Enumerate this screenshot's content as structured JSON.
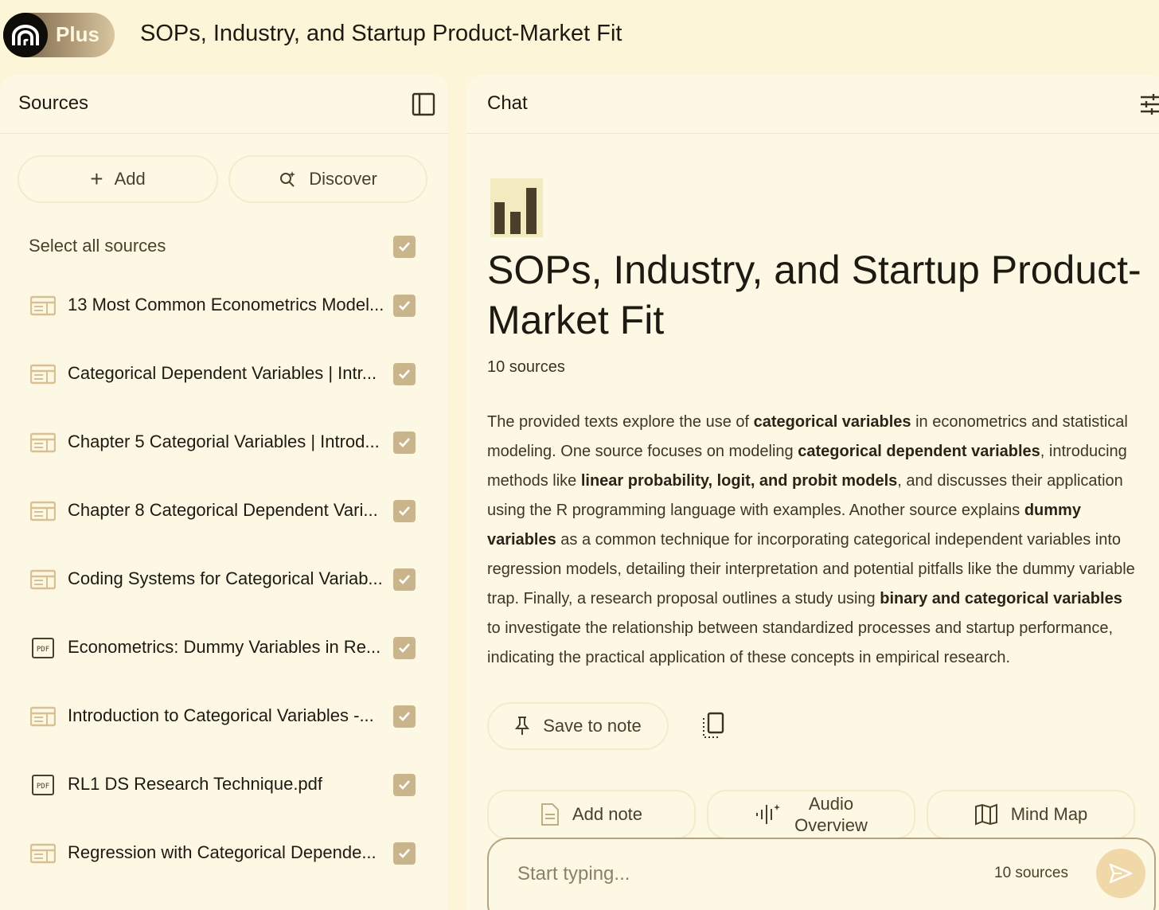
{
  "app": {
    "logo_label": "Plus",
    "title": "SOPs, Industry, and Startup Product-Market Fit"
  },
  "sources_panel": {
    "title": "Sources",
    "add_label": "Add",
    "discover_label": "Discover",
    "select_all_label": "Select all sources",
    "items": [
      {
        "label": "13 Most Common Econometrics Model...",
        "type": "web"
      },
      {
        "label": "Categorical Dependent Variables | Intr...",
        "type": "web"
      },
      {
        "label": "Chapter 5 Categorial Variables | Introd...",
        "type": "web"
      },
      {
        "label": "Chapter 8 Categorical Dependent Vari...",
        "type": "web"
      },
      {
        "label": "Coding Systems for Categorical Variab...",
        "type": "web"
      },
      {
        "label": "Econometrics: Dummy Variables in Re...",
        "type": "pdf"
      },
      {
        "label": "Introduction to Categorical Variables -...",
        "type": "web"
      },
      {
        "label": "RL1 DS Research Technique.pdf",
        "type": "pdf"
      },
      {
        "label": "Regression with Categorical Depende...",
        "type": "web"
      }
    ]
  },
  "chat_panel": {
    "title": "Chat",
    "notebook_title": "SOPs, Industry, and Startup Product-Market Fit",
    "source_count": "10 sources",
    "summary": {
      "p1": "The provided texts explore the use of ",
      "b1": "categorical variables",
      "p2": " in econometrics and statistical modeling. One source focuses on modeling ",
      "b2": "categorical dependent variables",
      "p3": ", introducing methods like ",
      "b3": "linear probability, logit, and probit models",
      "p4": ", and discusses their application using the R programming language with examples. Another source explains ",
      "b4": "dummy variables",
      "p5": " as a common technique for incorporating categorical independent variables into regression models, detailing their interpretation and potential pitfalls like the dummy variable trap. Finally, a research proposal outlines a study using ",
      "b5": "binary and categorical variables",
      "p6": " to investigate the relationship between standardized processes and startup performance, indicating the practical application of these concepts in empirical research."
    },
    "save_to_note_label": "Save to note",
    "add_note_label": "Add note",
    "audio_overview_label_1": "Audio",
    "audio_overview_label_2": "Overview",
    "mind_map_label": "Mind Map",
    "input_placeholder": "Start typing...",
    "input_source_count": "10 sources"
  },
  "colors": {
    "background": "#fcf5d8",
    "panel": "#fdf8e4",
    "checkbox": "#c9b48c",
    "send_button": "#f1d8a8"
  }
}
